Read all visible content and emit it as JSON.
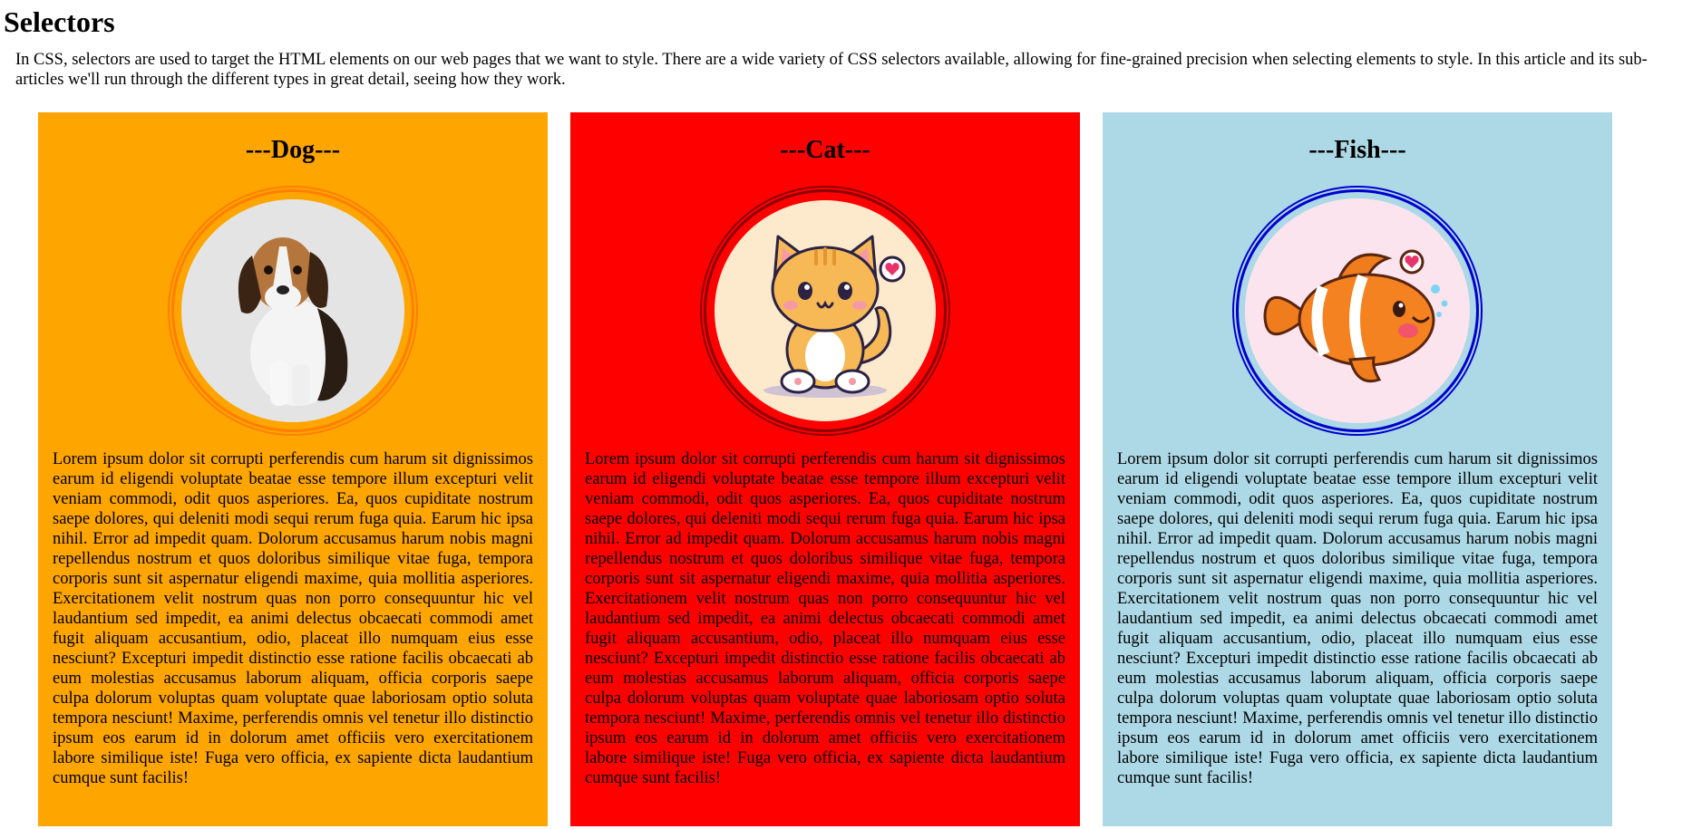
{
  "page": {
    "title": "Selectors",
    "intro": "In CSS, selectors are used to target the HTML elements on our web pages that we want to style. There are a wide variety of CSS selectors available, allowing for fine-grained precision when selecting elements to style. In this article and its sub-articles we'll run through the different types in great detail, seeing how they work."
  },
  "cards": [
    {
      "title": "---Dog---",
      "image_icon": "beagle-puppy-photo",
      "background": "#ffa500",
      "ring_color": "#ff7f00",
      "text": "Lorem ipsum dolor sit corrupti perferendis cum harum sit dignissimos earum id eligendi voluptate beatae esse tempore illum excepturi velit veniam commodi, odit quos asperiores. Ea, quos cupiditate nostrum saepe dolores, qui deleniti modi sequi rerum fuga quia. Earum hic ipsa nihil. Error ad impedit quam. Dolorum accusamus harum nobis magni repellendus nostrum et quos doloribus similique vitae fuga, tempora corporis sunt sit aspernatur eligendi maxime, quia mollitia asperiores. Exercitationem velit nostrum quas non porro consequuntur hic vel laudantium sed impedit, ea animi delectus obcaecati commodi amet fugit aliquam accusantium, odio, placeat illo numquam eius esse nesciunt? Excepturi impedit distinctio esse ratione facilis obcaecati ab eum molestias accusamus laborum aliquam, officia corporis saepe culpa dolorum voluptas quam voluptate quae laboriosam optio soluta tempora nesciunt! Maxime, perferendis omnis vel tenetur illo distinctio ipsum eos earum id in dolorum amet officiis vero exercitationem labore similique iste! Fuga vero officia, ex sapiente dicta laudantium cumque sunt facilis!"
    },
    {
      "title": "---Cat---",
      "image_icon": "cartoon-cat-illustration",
      "background": "#ff0000",
      "ring_color": "#8b0000",
      "text": "Lorem ipsum dolor sit corrupti perferendis cum harum sit dignissimos earum id eligendi voluptate beatae esse tempore illum excepturi velit veniam commodi, odit quos asperiores. Ea, quos cupiditate nostrum saepe dolores, qui deleniti modi sequi rerum fuga quia. Earum hic ipsa nihil. Error ad impedit quam. Dolorum accusamus harum nobis magni repellendus nostrum et quos doloribus similique vitae fuga, tempora corporis sunt sit aspernatur eligendi maxime, quia mollitia asperiores. Exercitationem velit nostrum quas non porro consequuntur hic vel laudantium sed impedit, ea animi delectus obcaecati commodi amet fugit aliquam accusantium, odio, placeat illo numquam eius esse nesciunt? Excepturi impedit distinctio esse ratione facilis obcaecati ab eum molestias accusamus laborum aliquam, officia corporis saepe culpa dolorum voluptas quam voluptate quae laboriosam optio soluta tempora nesciunt! Maxime, perferendis omnis vel tenetur illo distinctio ipsum eos earum id in dolorum amet officiis vero exercitationem labore similique iste! Fuga vero officia, ex sapiente dicta laudantium cumque sunt facilis!"
    },
    {
      "title": "---Fish---",
      "image_icon": "cartoon-clownfish-illustration",
      "background": "#add8e6",
      "ring_color": "#0000cd",
      "text": "Lorem ipsum dolor sit corrupti perferendis cum harum sit dignissimos earum id eligendi voluptate beatae esse tempore illum excepturi velit veniam commodi, odit quos asperiores. Ea, quos cupiditate nostrum saepe dolores, qui deleniti modi sequi rerum fuga quia. Earum hic ipsa nihil. Error ad impedit quam. Dolorum accusamus harum nobis magni repellendus nostrum et quos doloribus similique vitae fuga, tempora corporis sunt sit aspernatur eligendi maxime, quia mollitia asperiores. Exercitationem velit nostrum quas non porro consequuntur hic vel laudantium sed impedit, ea animi delectus obcaecati commodi amet fugit aliquam accusantium, odio, placeat illo numquam eius esse nesciunt? Excepturi impedit distinctio esse ratione facilis obcaecati ab eum molestias accusamus laborum aliquam, officia corporis saepe culpa dolorum voluptas quam voluptate quae laboriosam optio soluta tempora nesciunt! Maxime, perferendis omnis vel tenetur illo distinctio ipsum eos earum id in dolorum amet officiis vero exercitationem labore similique iste! Fuga vero officia, ex sapiente dicta laudantium cumque sunt facilis!"
    }
  ]
}
